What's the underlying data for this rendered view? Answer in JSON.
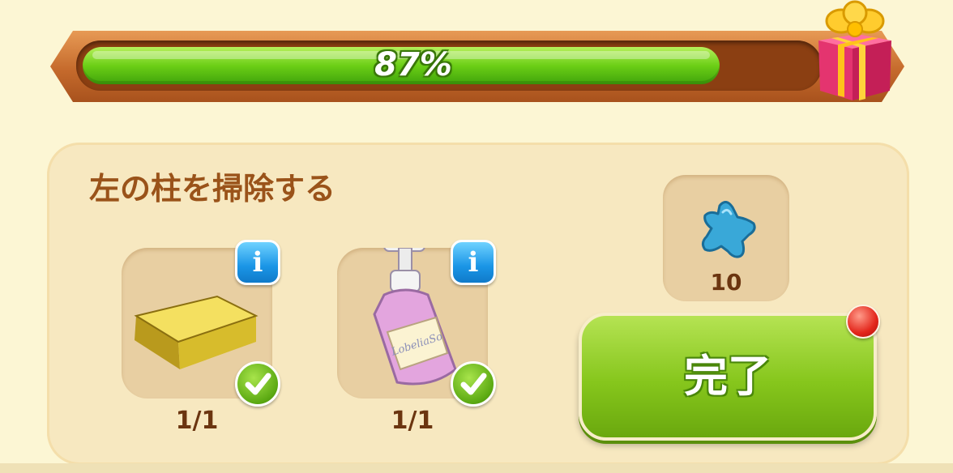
{
  "progress": {
    "percent": 87,
    "label": "87%"
  },
  "reward_icon": "gift-box-icon",
  "task": {
    "title": "左の柱を掃除する",
    "items": [
      {
        "icon": "sponge-icon",
        "count": "1/1",
        "completed": true
      },
      {
        "icon": "soap-bottle-icon",
        "count": "1/1",
        "completed": true,
        "bottle_text": "LobeliaSo"
      }
    ],
    "reward": {
      "icon": "blue-star-icon",
      "amount": "10"
    },
    "complete_button": {
      "label": "完了",
      "has_notification": true
    }
  },
  "colors": {
    "progress_fill": "#6ccf16",
    "title": "#9a531a",
    "button": "#86c61c",
    "info": "#1a95e6",
    "notification": "#e3261b"
  }
}
